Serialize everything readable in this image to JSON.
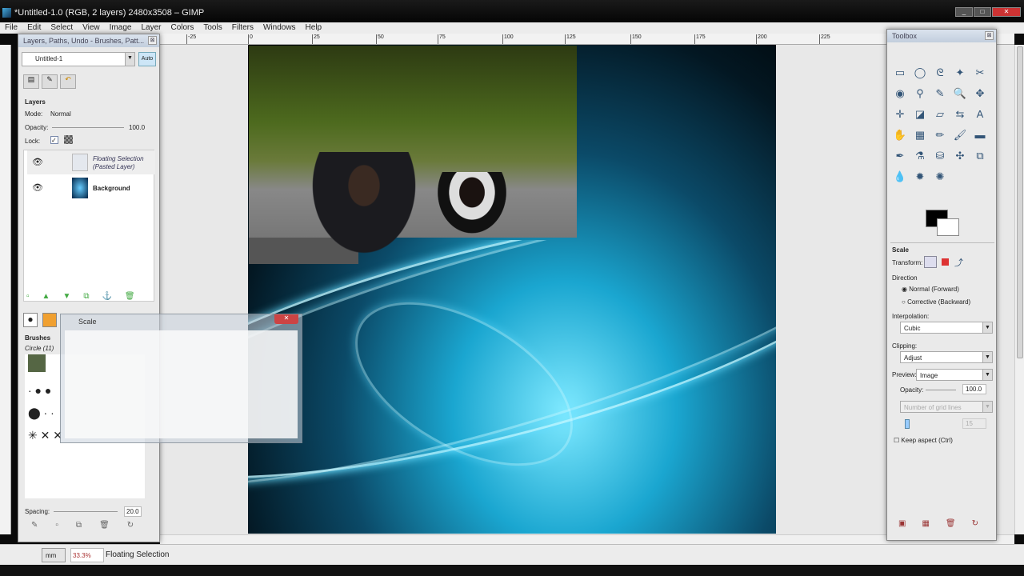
{
  "window": {
    "title": "*Untitled-1.0 (RGB, 2 layers) 2480x3508 – GIMP",
    "min": "_",
    "max": "□",
    "close": "✕"
  },
  "menu": [
    "File",
    "Edit",
    "Select",
    "View",
    "Image",
    "Layer",
    "Colors",
    "Tools",
    "Filters",
    "Windows",
    "Help"
  ],
  "ruler": [
    "-25",
    "0",
    "25",
    "50",
    "75",
    "100",
    "125",
    "150",
    "175",
    "200",
    "225"
  ],
  "left_dock": {
    "title": "Layers, Paths, Undo - Brushes, Patt...",
    "image_select": "Untitled-1",
    "auto": "Auto",
    "layers": {
      "heading": "Layers",
      "mode_label": "Mode:",
      "mode": "Normal",
      "opacity_label": "Opacity:",
      "opacity": "100.0",
      "lock_label": "Lock:",
      "items": [
        {
          "name": "Floating Selection",
          "sub": "(Pasted Layer)"
        },
        {
          "name": "Background"
        }
      ]
    },
    "brushes": {
      "heading": "Brushes",
      "selected": "Circle (11)",
      "spacing_label": "Spacing:",
      "spacing": "20.0"
    }
  },
  "scale_dialog": {
    "title": "Scale"
  },
  "toolbox": {
    "title": "Toolbox",
    "tools": [
      "▭",
      "◯",
      "ᘓ",
      "✦",
      "✂",
      "◉",
      "⚲",
      "✎",
      "🔍",
      "✥",
      "✛",
      "◪",
      "▱",
      "⇆",
      "A",
      "✋",
      "▦",
      "✏",
      "🖌",
      "▬",
      "✒",
      "⚗",
      "⛁",
      "✣",
      "⧉",
      "💧",
      "✹",
      "✺"
    ],
    "options": {
      "heading": "Scale",
      "transform_label": "Transform:",
      "direction_label": "Direction",
      "dir_normal": "Normal (Forward)",
      "dir_corrective": "Corrective (Backward)",
      "interp_label": "Interpolation:",
      "interp": "Cubic",
      "clipping_label": "Clipping:",
      "clipping": "Adjust",
      "preview_label": "Preview:",
      "preview": "Image",
      "opacity_label": "Opacity:",
      "opacity": "100.0",
      "grid": "Number of grid lines",
      "grid_value": "15",
      "keep_aspect": "Keep aspect  (Ctrl)"
    }
  },
  "status": {
    "unit": "mm",
    "zoom": "33.3%",
    "message": "Floating Selection"
  }
}
